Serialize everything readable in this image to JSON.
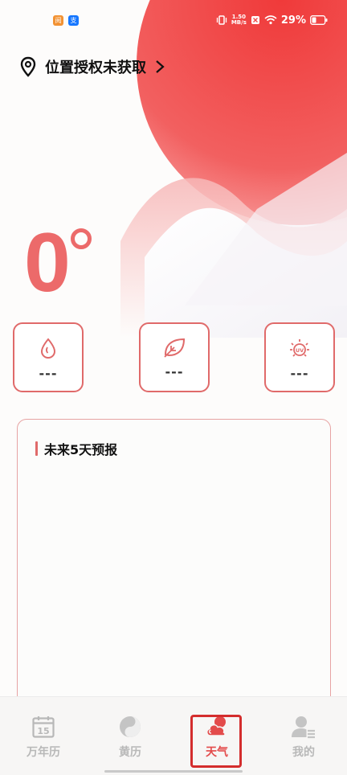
{
  "status_bar": {
    "app_badges": [
      {
        "text": "阅",
        "color": "#f29233"
      },
      {
        "text": "支",
        "color": "#1677ff"
      }
    ],
    "net_speed_value": "1.50",
    "net_speed_unit": "MB/s",
    "battery": "29%"
  },
  "location": {
    "text": "位置授权未获取"
  },
  "weather": {
    "temperature": "0",
    "stats": [
      {
        "icon": "humidity-icon",
        "value": "---"
      },
      {
        "icon": "leaf-icon",
        "value": "---"
      },
      {
        "icon": "uv-icon",
        "value": "---"
      }
    ]
  },
  "forecast": {
    "title": "未来5天预报"
  },
  "tabbar": {
    "items": [
      {
        "label": "万年历",
        "icon": "calendar-icon",
        "active": false
      },
      {
        "label": "黄历",
        "icon": "yin-yang-icon",
        "active": false
      },
      {
        "label": "天气",
        "icon": "cloud-sun-icon",
        "active": true
      },
      {
        "label": "我的",
        "icon": "profile-icon",
        "active": false
      }
    ]
  },
  "colors": {
    "accent": "#e06a6a",
    "temperature": "#ec6a6a",
    "active_tab": "#e34b4b",
    "highlight_box": "#d42d2d"
  }
}
